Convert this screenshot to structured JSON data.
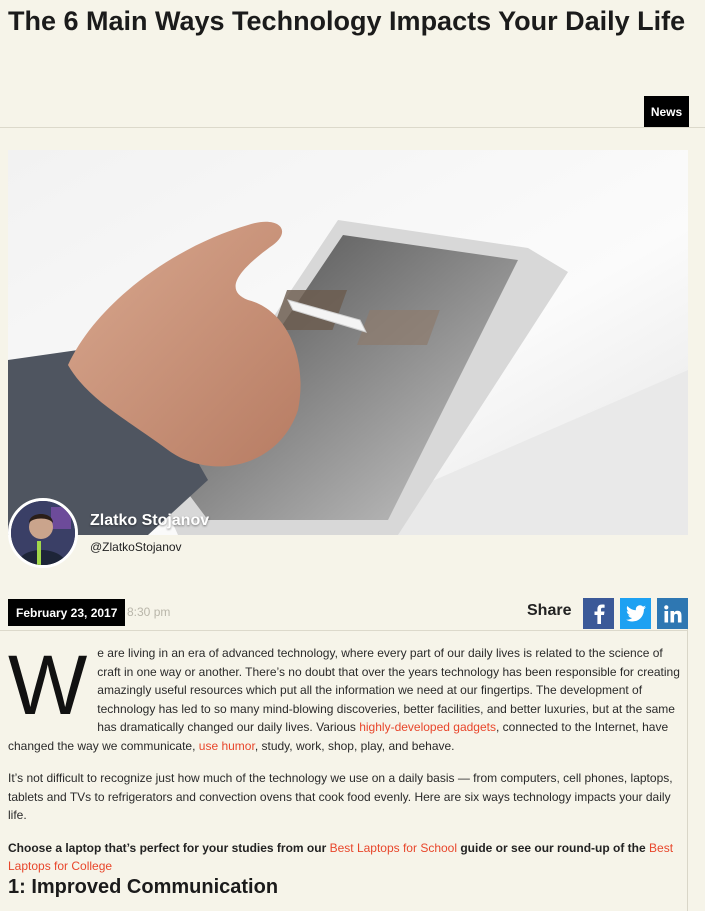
{
  "article": {
    "title": "The 6 Main Ways Technology Impacts Your Daily Life",
    "category": "News",
    "hero_image": "tablet-with-stylus-photo",
    "author": {
      "name": "Zlatko Stojanov",
      "handle": "@ZlatkoStojanov"
    },
    "date": "February 23, 2017",
    "time": "8:30 pm",
    "share": {
      "label": "Share",
      "buttons": [
        "facebook-icon",
        "twitter-icon",
        "linkedin-icon"
      ],
      "colors": {
        "facebook": "#3b5998",
        "twitter": "#1da1f2",
        "linkedin": "#2e77b2"
      }
    },
    "body": {
      "p1": {
        "dropcap": "W",
        "t1": "e are living in an era of advanced technology, where every part of our daily lives is related to the science of craft in one way or another. There’s no doubt that over the years technology has been responsible for creating amazingly useful resources which put all the information we need at our fingertips. The development of technology has led to so many mind-blowing discoveries, better facilities, and better luxuries, but at the same has dramatically changed our daily lives. Various ",
        "link1": "highly-developed gadgets",
        "t2": ", connected to the Internet, have changed the way we communicate, ",
        "link2": "use humor",
        "t3": ", study, work, shop, play, and behave."
      },
      "p2": "It’s not difficult to recognize just how much of the technology we use on a daily basis — from computers, cell phones, laptops, tablets and TVs to refrigerators and convection ovens that cook food evenly. Here are six ways technology impacts your daily life.",
      "p3": {
        "t1": "Choose a laptop that’s perfect for your studies from our ",
        "link1": "Best Laptops for School",
        "t2": " guide or see our round-up of the ",
        "link2": "Best Laptops for College"
      }
    },
    "subheading": "1: Improved Communication",
    "link_color": "#e8462b",
    "background": "#f6f4e9"
  }
}
